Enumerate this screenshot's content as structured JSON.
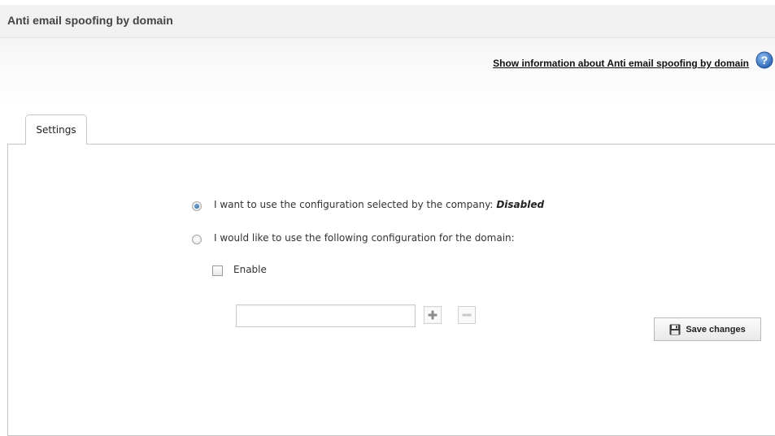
{
  "header": {
    "title": "Anti email spoofing by domain"
  },
  "info": {
    "link_text": "Show information about Anti email spoofing by domain",
    "icon": "help-icon"
  },
  "tabs": [
    {
      "label": "Settings",
      "active": true
    }
  ],
  "options": {
    "company": {
      "label": "I want to use the configuration selected by the company:",
      "value": "Disabled",
      "selected": true
    },
    "domain": {
      "label": "I would like to use the following configuration for the domain:",
      "selected": false
    }
  },
  "enable": {
    "label": "Enable",
    "checked": false
  },
  "domain_input": {
    "value": "",
    "placeholder": ""
  },
  "buttons": {
    "add_icon": "plus-icon",
    "remove_icon": "minus-icon",
    "save_label": "Save changes",
    "save_icon": "floppy-disk-icon"
  },
  "colors": {
    "help_icon": "#2f6fc0",
    "add_icon": "#8a8a8a",
    "remove_icon": "#c8c8c8"
  }
}
